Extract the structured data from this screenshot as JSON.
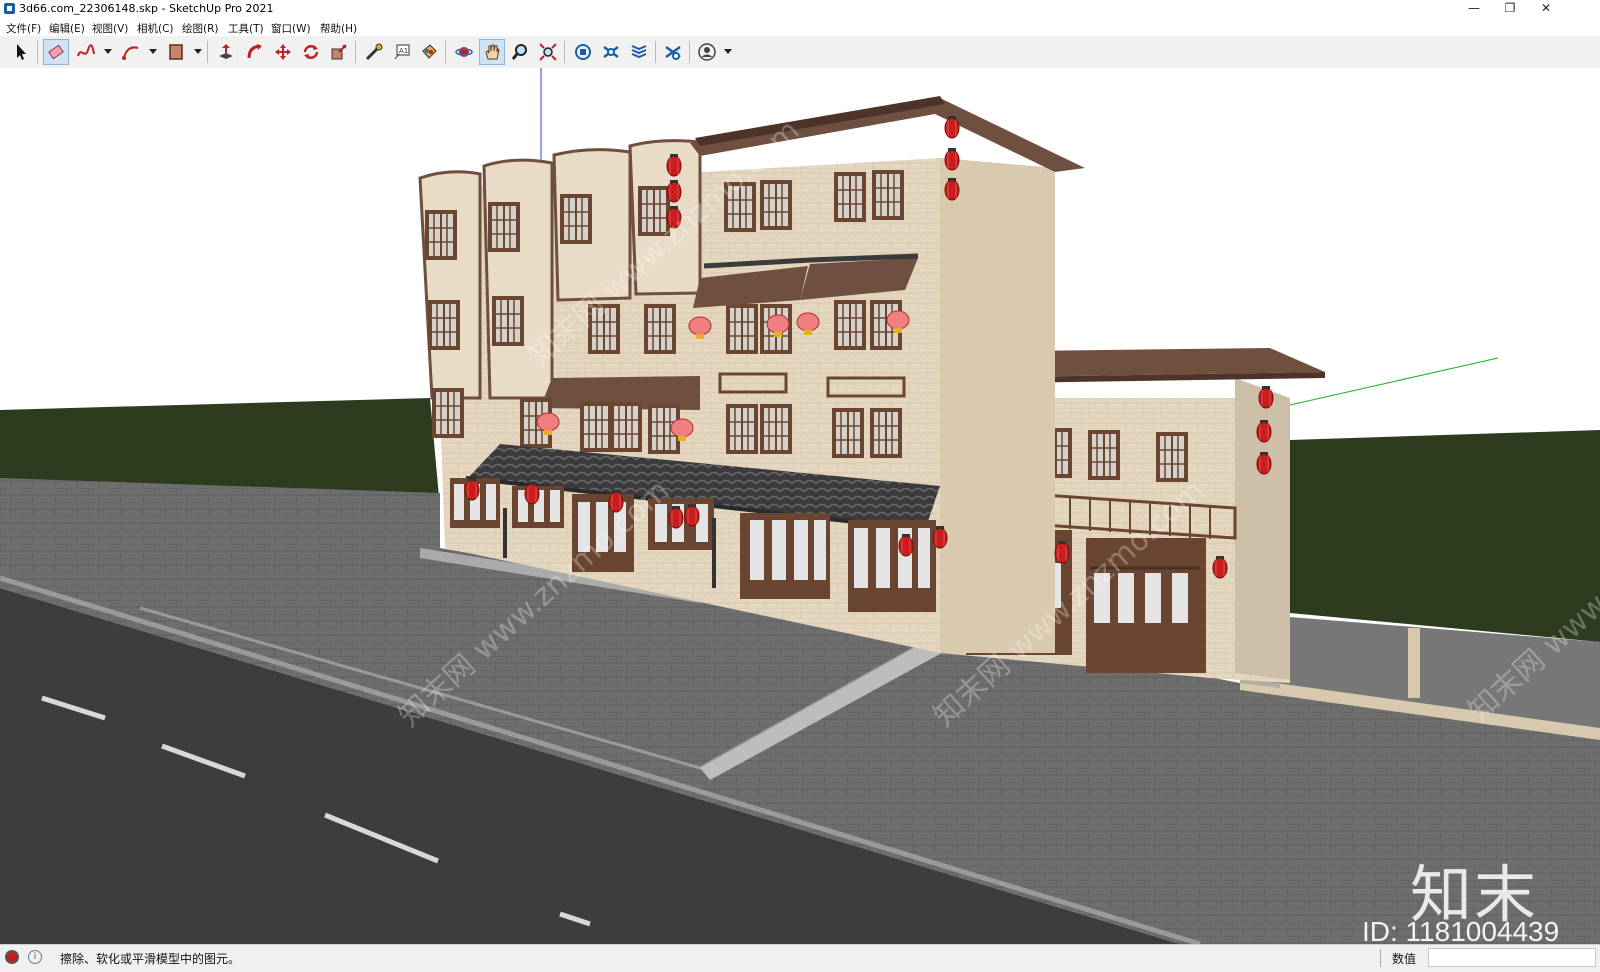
{
  "window": {
    "title": "3d66.com_22306148.skp - SketchUp Pro 2021",
    "minimize_glyph": "—",
    "restore_glyph": "❐",
    "close_glyph": "✕"
  },
  "menu": [
    "文件(F)",
    "编辑(E)",
    "视图(V)",
    "相机(C)",
    "绘图(R)",
    "工具(T)",
    "窗口(W)",
    "帮助(H)"
  ],
  "toolbar": {
    "tools": [
      "select-icon",
      "eraser-icon",
      "freehand-line-icon",
      "arc-icon",
      "rectangle-icon",
      "push-pull-icon",
      "follow-me-icon",
      "move-icon",
      "rotate-icon",
      "scale-icon",
      "tape-measure-icon",
      "text-icon",
      "paint-bucket-icon",
      "orbit-icon",
      "pan-icon",
      "zoom-icon",
      "zoom-extents-icon",
      "warehouse-icon",
      "extension-warehouse-icon",
      "layout-icon",
      "extension-manager-icon",
      "account-icon"
    ],
    "active_tool": "pan-icon"
  },
  "viewport": {
    "watermark_logo": "知末",
    "watermark_id": "ID: 1181004439",
    "watermark_repeat": "知末网 www.znzmo.com"
  },
  "status": {
    "message": "擦除、软化或平滑模型中的图元。",
    "measurement_label": "数值",
    "measurement_value": ""
  },
  "colors": {
    "wall": "#e6d8c2",
    "roof": "#6f4f3f",
    "lantern": "#c81e1e",
    "grass": "#2e3b1f",
    "paving": "#6e6e6e",
    "asphalt": "#3d3d3f"
  }
}
